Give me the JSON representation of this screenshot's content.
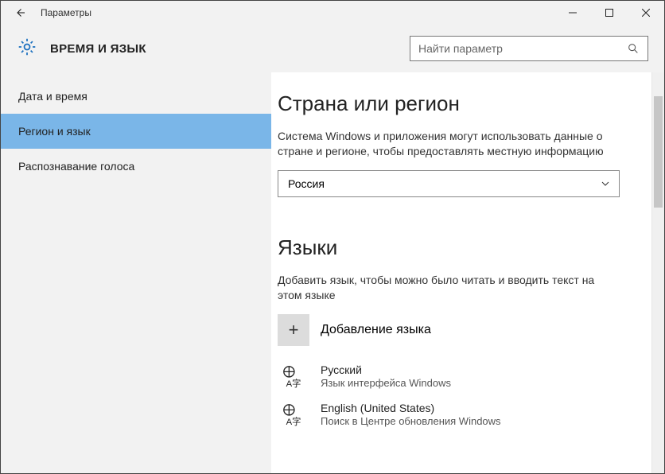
{
  "window": {
    "title": "Параметры"
  },
  "header": {
    "title": "ВРЕМЯ И ЯЗЫК",
    "search_placeholder": "Найти параметр"
  },
  "sidebar": {
    "items": [
      {
        "label": "Дата и время",
        "active": false
      },
      {
        "label": "Регион и язык",
        "active": true
      },
      {
        "label": "Распознавание голоса",
        "active": false
      }
    ]
  },
  "content": {
    "region": {
      "heading": "Страна или регион",
      "description": "Система Windows и приложения могут использовать данные о стране и регионе, чтобы предоставлять местную информацию",
      "selected": "Россия"
    },
    "languages": {
      "heading": "Языки",
      "description": "Добавить язык, чтобы можно было читать и вводить текст на этом языке",
      "add_label": "Добавление языка",
      "list": [
        {
          "name": "Русский",
          "sub": "Язык интерфейса Windows"
        },
        {
          "name": "English (United States)",
          "sub": "Поиск в Центре обновления Windows"
        }
      ]
    }
  }
}
